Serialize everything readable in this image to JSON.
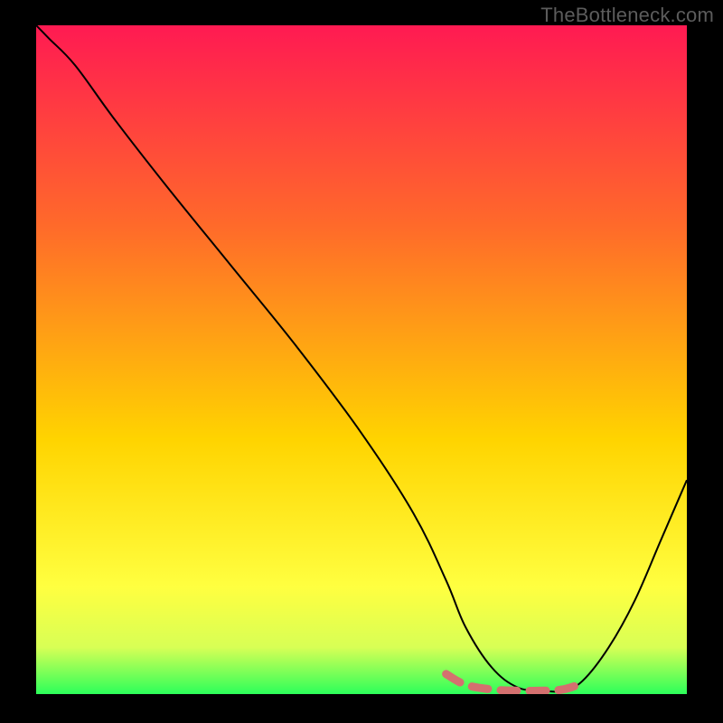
{
  "watermark": "TheBottleneck.com",
  "chart_data": {
    "type": "line",
    "title": "",
    "xlabel": "",
    "ylabel": "",
    "xlim": [
      0,
      100
    ],
    "ylim": [
      0,
      100
    ],
    "grid": false,
    "legend": false,
    "background_gradient_top": "#ff1a52",
    "background_gradient_mid": "#ffd400",
    "background_gradient_bottom": "#2cff5a",
    "annotations": [],
    "series": [
      {
        "name": "bottleneck-curve",
        "color": "#000000",
        "stroke_width": 2,
        "x": [
          0,
          2,
          6,
          12,
          20,
          30,
          40,
          50,
          58,
          63,
          66,
          70,
          74,
          78,
          81,
          84,
          88,
          92,
          96,
          100
        ],
        "values": [
          100,
          98,
          94,
          86,
          76,
          64,
          52,
          39,
          27,
          17,
          10,
          4,
          1,
          0.5,
          0.5,
          2,
          7,
          14,
          23,
          32
        ]
      },
      {
        "name": "flat-zone-marker",
        "color": "#d4706f",
        "stroke_width": 9,
        "dash": "18 14",
        "linecap": "round",
        "x": [
          63,
          66,
          70,
          74,
          78,
          81,
          84
        ],
        "values": [
          3,
          1.4,
          0.7,
          0.5,
          0.5,
          0.7,
          1.6
        ]
      }
    ]
  }
}
